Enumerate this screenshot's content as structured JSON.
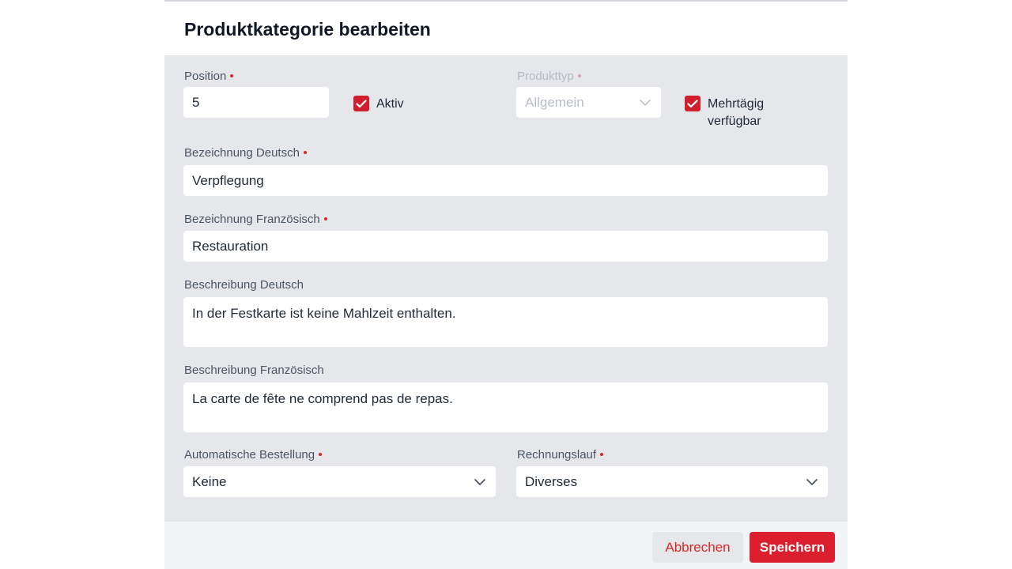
{
  "dialog": {
    "title": "Produktkategorie bearbeiten"
  },
  "fields": {
    "position": {
      "label": "Position",
      "value": "5"
    },
    "aktiv": {
      "label": "Aktiv",
      "checked": true
    },
    "produkttyp": {
      "label": "Produkttyp",
      "value": "Allgemein",
      "disabled": true
    },
    "mehrtaegig": {
      "label_line1": "Mehrtägig",
      "label_line2": "verfügbar",
      "checked": true
    },
    "bezeichnung_de": {
      "label": "Bezeichnung Deutsch",
      "value": "Verpflegung"
    },
    "bezeichnung_fr": {
      "label": "Bezeichnung Französisch",
      "value": "Restauration"
    },
    "beschreibung_de": {
      "label": "Beschreibung Deutsch",
      "value": "In der Festkarte ist keine Mahlzeit enthalten."
    },
    "beschreibung_fr": {
      "label": "Beschreibung Französisch",
      "value": "La carte de fête ne comprend pas de repas."
    },
    "auto_bestellung": {
      "label": "Automatische Bestellung",
      "value": "Keine"
    },
    "rechnungslauf": {
      "label": "Rechnungslauf",
      "value": "Diverses"
    }
  },
  "footer": {
    "cancel_label": "Abbrechen",
    "save_label": "Speichern"
  },
  "colors": {
    "accent": "#dc1f2e",
    "body_background": "#e5e7eb",
    "footer_background": "#f3f4f6"
  }
}
